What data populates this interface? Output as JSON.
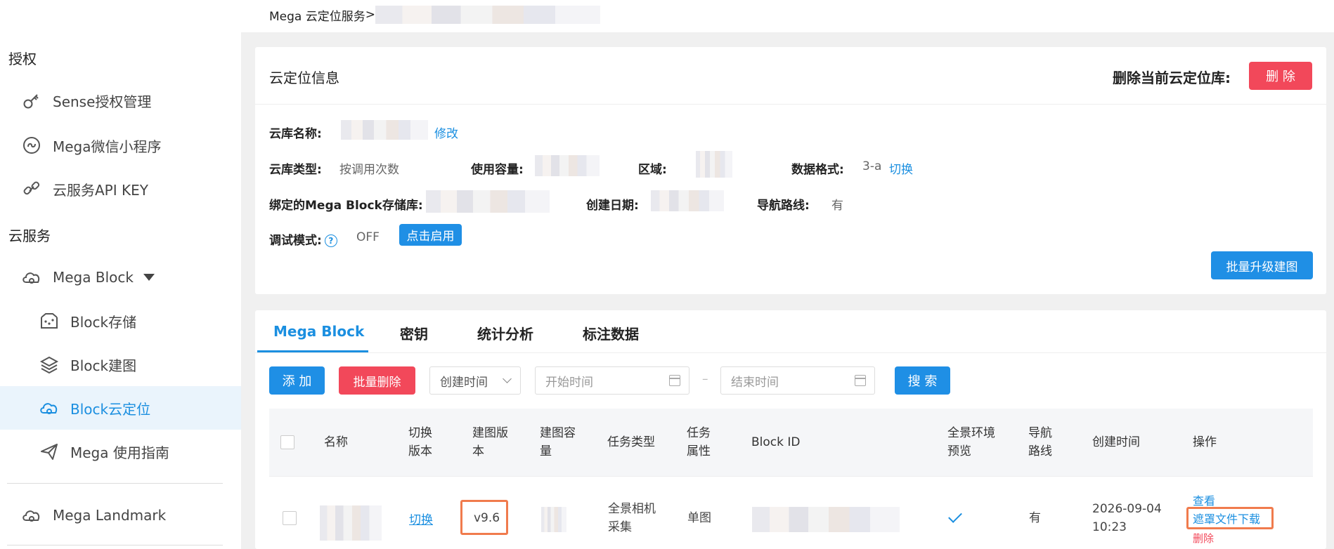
{
  "sidebar": {
    "section_auth": "授权",
    "auth_items": [
      {
        "label": "Sense授权管理",
        "icon": "key-icon"
      },
      {
        "label": "Mega微信小程序",
        "icon": "miniprogram-icon"
      },
      {
        "label": "云服务API KEY",
        "icon": "link-icon"
      }
    ],
    "section_cloud": "云服务",
    "mega_block": {
      "label": "Mega Block",
      "icon": "cloud-icon"
    },
    "block_items": [
      {
        "label": "Block存储",
        "icon": "storage-icon"
      },
      {
        "label": "Block建图",
        "icon": "layers-icon"
      },
      {
        "label": "Block云定位",
        "icon": "cloud-locate-icon",
        "active": true
      },
      {
        "label": "Mega 使用指南",
        "icon": "send-icon"
      }
    ],
    "landmark": {
      "label": "Mega Landmark",
      "icon": "cloud-icon"
    }
  },
  "breadcrumb": {
    "root": "Mega 云定位服务",
    "sep": ">"
  },
  "info": {
    "title": "云定位信息",
    "delete_label": "删除当前云定位库:",
    "delete_button": "删 除",
    "name_label": "云库名称:",
    "edit_link": "修改",
    "type_label": "云库类型:",
    "type_value": "按调用次数",
    "capacity_label": "使用容量:",
    "region_label": "区域:",
    "format_label": "数据格式:",
    "format_value": "3-a",
    "switch_link": "切换",
    "bound_label": "绑定的Mega Block存储库:",
    "created_label": "创建日期:",
    "nav_label": "导航路线:",
    "nav_value": "有",
    "debug_label": "调试模式:",
    "debug_help": "?",
    "debug_value": "OFF",
    "enable_button": "点击启用",
    "batch_upgrade_button": "批量升级建图"
  },
  "tabs": [
    "Mega Block",
    "密钥",
    "统计分析",
    "标注数据"
  ],
  "toolbar": {
    "add_button": "添 加",
    "batch_delete_button": "批量删除",
    "sort_select": "创建时间",
    "start_placeholder": "开始时间",
    "range_sep": "–",
    "end_placeholder": "结束时间",
    "search_button": "搜 索"
  },
  "table": {
    "columns": [
      "名称",
      "切换\n版本",
      "建图版\n本",
      "建图容\n量",
      "任务类型",
      "任务\n属性",
      "Block ID",
      "全景环境\n预览",
      "导航\n路线",
      "创建时间",
      "操作"
    ],
    "rows": [
      {
        "switch": "切换",
        "version": "v9.6",
        "task_type": "全景相机\n采集",
        "task_attr": "单图",
        "nav": "有",
        "created": "2026-09-04\n10:23",
        "actions": [
          "查看",
          "遮罩文件下载",
          "删除"
        ]
      }
    ]
  },
  "colors": {
    "accent": "#1b8fe0",
    "danger": "#f2485a",
    "highlight": "#f07b4d"
  }
}
